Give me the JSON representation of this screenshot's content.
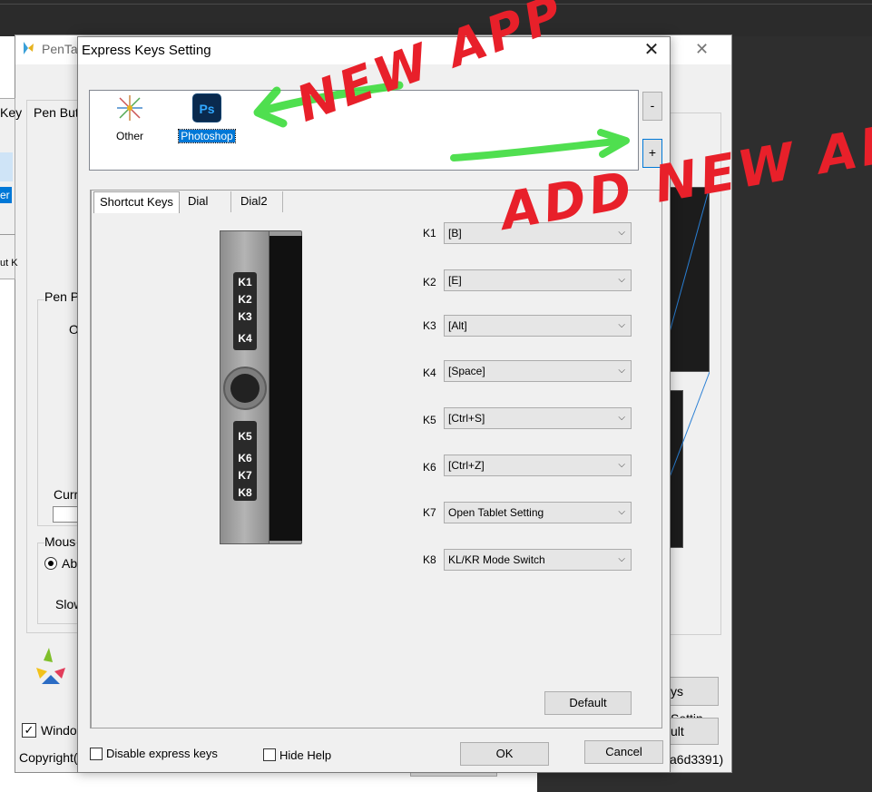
{
  "background_window": {
    "title": "PenTa",
    "pen_buttons_label": "Pen But",
    "pen_pressure_label": "Pen P",
    "o_label": "O",
    "current_label": "Curr",
    "mouse_group_label": "Mous",
    "absolute_radio_label": "Ab",
    "slow_label": "Slow",
    "windows_checkbox_label": "Windo",
    "copyright_label": "Copyright(",
    "keys_label": "Key",
    "er_label": "er",
    "ut_label": "ut K",
    "express_keys_setting_button": "ys Settin",
    "default_button_partial": "ult",
    "version_text": "a6d3391)"
  },
  "dialog": {
    "title": "Express Keys Setting",
    "apps": [
      {
        "label": "Other",
        "icon": "other-app-icon"
      },
      {
        "label": "Photoshop",
        "icon": "photoshop-icon",
        "icon_text": "Ps",
        "selected": true
      }
    ],
    "remove_button": "-",
    "add_button": "+",
    "tabs": [
      {
        "label": "Shortcut Keys",
        "active": true
      },
      {
        "label": "Dial"
      },
      {
        "label": "Dial2"
      }
    ],
    "tablet_keys": [
      "K1",
      "K2",
      "K3",
      "K4",
      "K5",
      "K6",
      "K7",
      "K8"
    ],
    "key_assignments": [
      {
        "key": "K1",
        "value": "[B]"
      },
      {
        "key": "K2",
        "value": "[E]"
      },
      {
        "key": "K3",
        "value": "[Alt]"
      },
      {
        "key": "K4",
        "value": "[Space]"
      },
      {
        "key": "K5",
        "value": "[Ctrl+S]"
      },
      {
        "key": "K6",
        "value": "[Ctrl+Z]"
      },
      {
        "key": "K7",
        "value": "Open Tablet Setting"
      },
      {
        "key": "K8",
        "value": "KL/KR Mode Switch"
      }
    ],
    "default_button": "Default",
    "disable_checkbox": "Disable express keys",
    "hide_help_checkbox": "Hide Help",
    "ok_button": "OK",
    "cancel_button": "Cancel"
  },
  "annotations": {
    "new_app_text": "NEW APP",
    "add_new_app_text": "ADD NEW APP",
    "red_color": "#e8202a",
    "green_color": "#3ddc3d"
  },
  "colors": {
    "selection": "#0078d7",
    "dialog_bg": "#f0f0f0",
    "dark_bg": "#2e2e2e"
  }
}
